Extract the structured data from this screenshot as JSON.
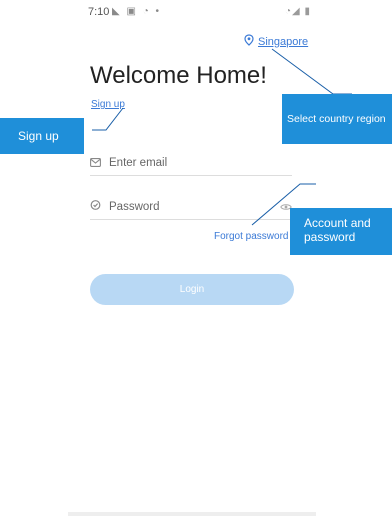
{
  "status_bar": {
    "time": "7:10",
    "left_icons": "◣ ▣ ◔ •",
    "right_icons": "◔◢ ▮"
  },
  "region": {
    "label": "Singapore",
    "icon": "location-pin-icon"
  },
  "title": "Welcome Home!",
  "signup_link": "Sign up",
  "email_field": {
    "placeholder": "Enter email",
    "value": "",
    "icon": "mail-icon"
  },
  "password_field": {
    "placeholder": "Password",
    "value": "",
    "icon": "lock-icon",
    "toggle_icon": "eye-icon"
  },
  "forgot_password": "Forgot password",
  "login_button": "Login",
  "annotations": {
    "sign_up": "Sign up",
    "select_country": "Select country region",
    "account_password": "Account and password"
  },
  "colors": {
    "link": "#3b7ad6",
    "callout": "#1f8fd9",
    "login_disabled": "#b8d8f4"
  }
}
